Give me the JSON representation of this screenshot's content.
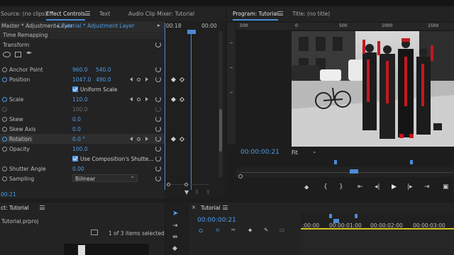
{
  "tabs_left": [
    {
      "label": "Source: (no clips)"
    },
    {
      "label": "Effect Controls"
    },
    {
      "label": "Text"
    },
    {
      "label": "Audio Clip Mixer: Tutorial"
    }
  ],
  "tabs_right": [
    {
      "label": "Program: Tutorial"
    },
    {
      "label": "Title: (no title)"
    }
  ],
  "effect_controls": {
    "master_clip": "Master * Adjustment Layer",
    "sequence_clip": "Tutorial * Adjustment Layer",
    "ruler_time": "00:18",
    "ruler_time2": "00:00",
    "section": "Time Remapping",
    "transform": "Transform",
    "properties": [
      {
        "name": "Anchor Point",
        "v1": "960.0",
        "v2": "540.0"
      },
      {
        "name": "Position",
        "v1": "1047.0",
        "v2": "490.0"
      },
      {
        "name": "Uniform Scale",
        "checkbox": true
      },
      {
        "name": "Scale",
        "v1": "110.0"
      },
      {
        "name": "",
        "v1": "100.0"
      },
      {
        "name": "Skew",
        "v1": "0.0"
      },
      {
        "name": "Skew Axis",
        "v1": "0.0"
      },
      {
        "name": "Rotation",
        "v1": "0.0 °"
      },
      {
        "name": "Opacity",
        "v1": "100.0"
      },
      {
        "name": "Use Composition's Shutte...",
        "checkbox": true
      },
      {
        "name": "Shutter Angle",
        "v1": "0.00"
      },
      {
        "name": "Sampling",
        "select": "Bilinear"
      }
    ],
    "footer_time": "00:21"
  },
  "program": {
    "ruler_marks": [
      "500",
      "0",
      "500",
      "1000",
      "1500"
    ],
    "timecode": "00:00:00:21",
    "fit": "Fit"
  },
  "project": {
    "title": "ct: Tutorial",
    "file": "Tutorial.prproj",
    "selected": "1 of 3 items selected"
  },
  "timeline": {
    "title": "Tutorial",
    "timecode": "00:00:00:21",
    "ruler": [
      ":00:00",
      "00:00:01:00",
      "00:00:02:00",
      "00:00:03:00"
    ]
  },
  "colors": {
    "accent": "#4a8cd6",
    "value_blue": "#4f9ce8",
    "panel": "#232323",
    "playhead": "#4a8cd6"
  }
}
